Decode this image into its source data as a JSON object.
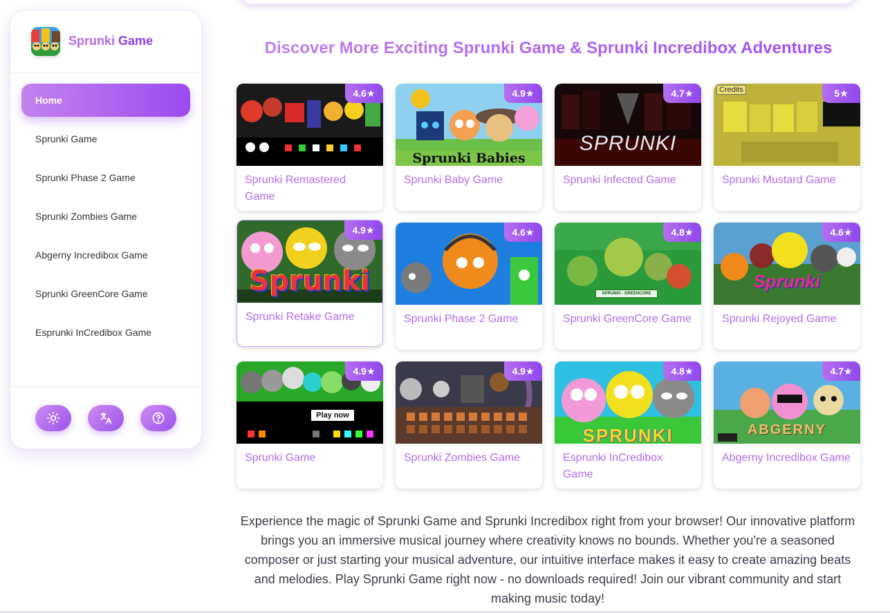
{
  "brand": {
    "name_part1": "Sprunki",
    "name_part2": "Game",
    "logo_icon": "sprunki-logo-icon"
  },
  "sidebar": {
    "items": [
      {
        "label": "Home",
        "active": true
      },
      {
        "label": "Sprunki Game"
      },
      {
        "label": "Sprunki Phase 2 Game"
      },
      {
        "label": "Sprunki Zombies Game"
      },
      {
        "label": "Abgerny Incredibox Game"
      },
      {
        "label": "Sprunki GreenCore Game"
      },
      {
        "label": "Esprunki InCredibox Game"
      }
    ],
    "footer_buttons": [
      {
        "icon": "sun-icon",
        "purpose": "theme toggle"
      },
      {
        "icon": "translate-icon",
        "purpose": "language"
      },
      {
        "icon": "help-icon",
        "purpose": "help"
      }
    ]
  },
  "main": {
    "heading": "Discover More Exciting Sprunki Game & Sprunki Incredibox Adventures",
    "cards": [
      {
        "title": "Sprunki Remastered Game",
        "rating": "4.6★",
        "thumb_text": ""
      },
      {
        "title": "Sprunki Baby Game",
        "rating": "4.9★",
        "thumb_text": "Sprunki Babies"
      },
      {
        "title": "Sprunki Infected Game",
        "rating": "4.7★",
        "thumb_text": "SPRUNKI"
      },
      {
        "title": "Sprunki Mustard Game",
        "rating": "5★",
        "thumb_text": "Credits"
      },
      {
        "title": "Sprunki Retake Game",
        "rating": "4.9★",
        "thumb_text": "Sprunki"
      },
      {
        "title": "Sprunki Phase 2 Game",
        "rating": "4.6★",
        "thumb_text": ""
      },
      {
        "title": "Sprunki GreenCore Game",
        "rating": "4.8★",
        "thumb_text": "SPRUNKI - GREENCORE"
      },
      {
        "title": "Sprunki Rejoyed Game",
        "rating": "4.6★",
        "thumb_text": "Sprunki"
      },
      {
        "title": "Sprunki Game",
        "rating": "4.9★",
        "thumb_text": "Play now"
      },
      {
        "title": "Sprunki Zombies Game",
        "rating": "4.9★",
        "thumb_text": ""
      },
      {
        "title": "Esprunki InCredibox Game",
        "rating": "4.8★",
        "thumb_text": "SPRUNKI"
      },
      {
        "title": "Abgerny Incredibox Game",
        "rating": "4.7★",
        "thumb_text": "ABGERNY"
      }
    ],
    "description": "Experience the magic of Sprunki Game and Sprunki Incredibox right from your browser! Our innovative platform brings you an immersive musical journey where creativity knows no bounds. Whether you're a seasoned composer or just starting your musical adventure, our intuitive interface makes it easy to create amazing beats and melodies. Play Sprunki Game right now - no downloads required! Join our vibrant community and start making music today!"
  },
  "colors": {
    "accent_start": "#c482ee",
    "accent_end": "#9b4bf0",
    "title_text": "#b06be8"
  }
}
